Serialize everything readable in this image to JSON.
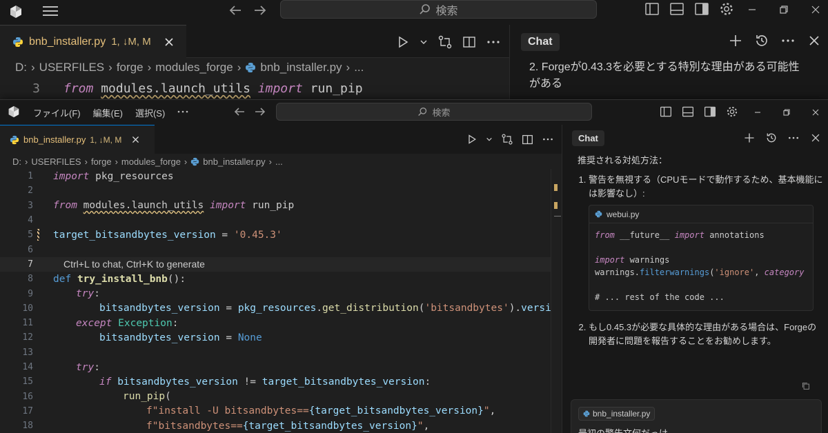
{
  "bg": {
    "search_placeholder": "検索",
    "tab": {
      "filename": "bnb_installer.py",
      "status": "1, ↓M, M"
    },
    "breadcrumb": [
      "D:",
      "USERFILES",
      "forge",
      "modules_forge",
      "bnb_installer.py",
      "..."
    ],
    "code_line": {
      "number": "3",
      "kw_from": "from",
      "module": "modules.launch_utils",
      "kw_import": "import",
      "name": "run_pip"
    },
    "chat": {
      "title": "Chat",
      "item_number": "2.",
      "item_text": "Forgeが0.43.3を必要とする特別な理由がある可能性がある"
    }
  },
  "fg": {
    "menu": [
      "ファイル(F)",
      "編集(E)",
      "選択(S)"
    ],
    "menu_more": "···",
    "search_placeholder": "検索",
    "tab": {
      "filename": "bnb_installer.py",
      "status": "1, ↓M, M"
    },
    "breadcrumb": [
      "D:",
      "USERFILES",
      "forge",
      "modules_forge",
      "bnb_installer.py",
      "..."
    ],
    "line_numbers": [
      "1",
      "2",
      "3",
      "4",
      "5",
      "6",
      "7",
      "8",
      "9",
      "10",
      "11",
      "12",
      "13",
      "14",
      "15",
      "16",
      "17",
      "18"
    ],
    "code": {
      "l1_kw": "import",
      "l1_rest": " pkg_resources",
      "l3_kw": "from",
      "l3_mod": "modules.launch_utils",
      "l3_kw2": "import",
      "l3_name": " run_pip",
      "l5_var": "target_bitsandbytes_version",
      "l5_eq": " = ",
      "l5_str": "'0.45.3'",
      "l7_hint": "Ctrl+L to chat, Ctrl+K to generate",
      "l8_def": "def",
      "l8_fn": "try_install_bnb",
      "l8_rest": "():",
      "l9_kw": "try",
      "l9_rest": ":",
      "l10_var": "bitsandbytes_version",
      "l10_eq": " = ",
      "l10_mod": "pkg_resources",
      "l10_dot": ".",
      "l10_fn": "get_distribution",
      "l10_p1": "(",
      "l10_str": "'bitsandbytes'",
      "l10_p2": ").",
      "l10_attr": "version",
      "l11_kw": "except",
      "l11_cls": "Exception",
      "l11_rest": ":",
      "l12_var": "bitsandbytes_version",
      "l12_eq": " = ",
      "l12_const": "None",
      "l14_kw": "try",
      "l14_rest": ":",
      "l15_kw": "if",
      "l15_var1": "bitsandbytes_version",
      "l15_op": " != ",
      "l15_var2": "target_bitsandbytes_version",
      "l15_rest": ":",
      "l16_fn": "run_pip",
      "l16_rest": "(",
      "l17_str1": "f\"install -U bitsandbytes==",
      "l17_brace": "{target_bitsandbytes_version}",
      "l17_str2": "\"",
      "l17_rest": ",",
      "l18_str1": "f\"bitsandbytes==",
      "l18_brace": "{target_bitsandbytes_version}",
      "l18_str2": "\"",
      "l18_rest": ","
    },
    "chat": {
      "title": "Chat",
      "intro": "推奨される対処方法：",
      "item1": "警告を無視する（CPUモードで動作するため、基本機能には影響なし）:",
      "code_file": "webui.py",
      "code_l1_kw": "from",
      "code_l1_mod": " __future__ ",
      "code_l1_kw2": "import",
      "code_l1_name": " annotations",
      "code_l3_kw": "import",
      "code_l3_name": " warnings",
      "code_l4_a": "warnings.",
      "code_l4_fn": "filterwarnings",
      "code_l4_b": "(",
      "code_l4_str": "'ignore'",
      "code_l4_c": ", ",
      "code_l4_d": "category",
      "code_l6": "# ... rest of the code ...",
      "item2": "もし0.45.3が必要な具体的な理由がある場合は、Forgeの開発者に問題を報告することをお勧めします。",
      "user_file_chip": "bnb_installer.py",
      "user_text": "最初の警告文何だっけ"
    }
  }
}
